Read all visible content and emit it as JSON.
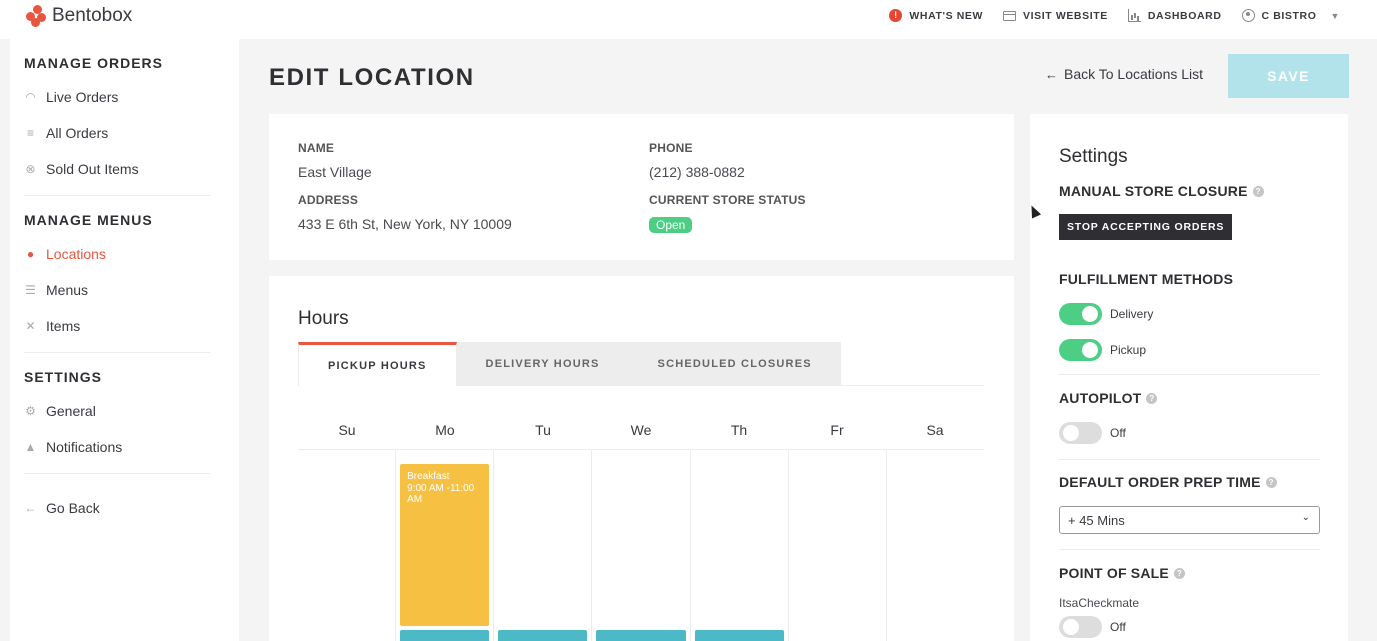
{
  "app": {
    "name": "Bentobox",
    "brand_color": "#e8563f"
  },
  "topnav": {
    "whats_new": "WHAT'S NEW",
    "visit_website": "VISIT WEBSITE",
    "dashboard": "DASHBOARD",
    "account": "C BISTRO"
  },
  "sidebar": {
    "sections": [
      {
        "title": "MANAGE ORDERS",
        "items": [
          {
            "label": "Live Orders",
            "icon": "rss-icon"
          },
          {
            "label": "All Orders",
            "icon": "list-icon"
          },
          {
            "label": "Sold Out Items",
            "icon": "x-circle-icon"
          }
        ]
      },
      {
        "title": "MANAGE MENUS",
        "items": [
          {
            "label": "Locations",
            "icon": "map-pin-icon",
            "active": true
          },
          {
            "label": "Menus",
            "icon": "menu-list-icon"
          },
          {
            "label": "Items",
            "icon": "utensils-icon"
          }
        ]
      },
      {
        "title": "SETTINGS",
        "items": [
          {
            "label": "General",
            "icon": "gear-icon"
          },
          {
            "label": "Notifications",
            "icon": "bell-icon"
          }
        ]
      }
    ],
    "go_back": "Go Back"
  },
  "header": {
    "title": "EDIT LOCATION",
    "back_link": "Back To Locations List",
    "save_label": "SAVE"
  },
  "location": {
    "name_label": "NAME",
    "name": "East Village",
    "phone_label": "PHONE",
    "phone": "(212) 388-0882",
    "address_label": "ADDRESS",
    "address": "433 E 6th St, New York, NY 10009",
    "status_label": "CURRENT STORE STATUS",
    "status": "Open"
  },
  "hours": {
    "title": "Hours",
    "tabs": [
      "PICKUP HOURS",
      "DELIVERY HOURS",
      "SCHEDULED CLOSURES"
    ],
    "active_tab": 0,
    "days": [
      "Su",
      "Mo",
      "Tu",
      "We",
      "Th",
      "Fr",
      "Sa"
    ],
    "blocks": [
      {
        "day": "Mo",
        "name": "Breakfast",
        "time": "9:00 AM -11:00 AM",
        "color": "#f6c143"
      }
    ]
  },
  "settings": {
    "title": "Settings",
    "manual_closure_label": "MANUAL STORE CLOSURE",
    "stop_button": "STOP ACCEPTING ORDERS",
    "fulfillment_label": "FULFILLMENT METHODS",
    "delivery_label": "Delivery",
    "pickup_label": "Pickup",
    "autopilot_label": "AUTOPILOT",
    "autopilot_state": "Off",
    "prep_time_label": "DEFAULT ORDER PREP TIME",
    "prep_time_value": "+ 45 Mins",
    "pos_label": "POINT OF SALE",
    "pos_provider": "ItsaCheckmate",
    "pos_state": "Off"
  }
}
